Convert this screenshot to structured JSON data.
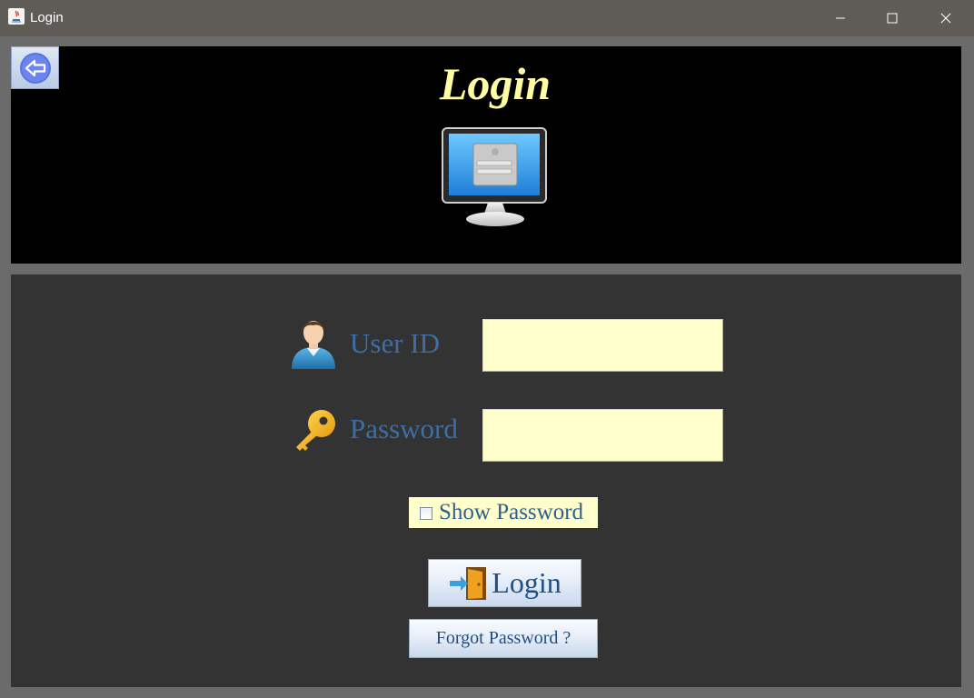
{
  "window": {
    "title": "Login"
  },
  "header": {
    "title": "Login"
  },
  "form": {
    "user_label": "User ID",
    "user_value": "",
    "password_label": "Password",
    "password_value": "",
    "show_password_label": "Show Password",
    "show_password_checked": false,
    "login_label": "Login",
    "forgot_label": "Forgot Password ?"
  },
  "icons": {
    "back": "arrow-left-icon",
    "header": "monitor-login-icon",
    "user": "user-icon",
    "password": "key-icon",
    "login": "door-enter-icon"
  },
  "colors": {
    "titlebar": "#5f5b57",
    "header_bg": "#000000",
    "header_title": "#fffba0",
    "panel_bg": "#333333",
    "label_text": "#3d6ea5",
    "input_bg": "#ffffcc"
  }
}
